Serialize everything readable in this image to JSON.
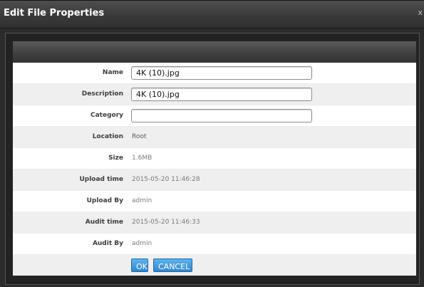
{
  "dialog": {
    "title": "Edit File Properties",
    "close_label": "x"
  },
  "form": {
    "name": {
      "label": "Name",
      "value": "4K (10).jpg"
    },
    "description": {
      "label": "Description",
      "value": "4K (10).jpg"
    },
    "category": {
      "label": "Category",
      "value": ""
    },
    "location": {
      "label": "Location",
      "value": "Root"
    },
    "size": {
      "label": "Size",
      "value": "1.6MB"
    },
    "upload_time": {
      "label": "Upload time",
      "value": "2015-05-20 11:46:28"
    },
    "upload_by": {
      "label": "Upload By",
      "value": "admin"
    },
    "audit_time": {
      "label": "Audit time",
      "value": "2015-05-20 11:46:33"
    },
    "audit_by": {
      "label": "Audit By",
      "value": "admin"
    }
  },
  "buttons": {
    "ok_label": "OK",
    "cancel_label": "CANCEL"
  },
  "colors": {
    "title_bar": "#3a3a3a",
    "button_blue": "#2f86cc"
  }
}
